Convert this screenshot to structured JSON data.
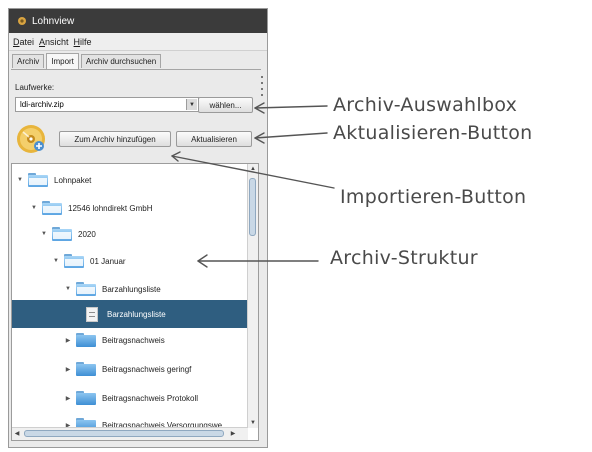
{
  "window": {
    "title": "Lohnview"
  },
  "menu": [
    {
      "mnemonic": "D",
      "rest": "atei"
    },
    {
      "mnemonic": "A",
      "rest": "nsicht"
    },
    {
      "mnemonic": "H",
      "rest": "ilfe"
    }
  ],
  "tabs": [
    "Archiv",
    "Import",
    "Archiv durchsuchen"
  ],
  "active_tab": "Import",
  "import_panel": {
    "drives_label": "Laufwerke:",
    "archive_value": "ldi-archiv.zip",
    "choose_label": "wählen...",
    "add_label": "Zum Archiv hinzufügen",
    "refresh_label": "Aktualisieren"
  },
  "tree": [
    {
      "label": "Lohnpaket",
      "type": "folder",
      "expanded": true
    },
    {
      "label": "12546 lohndirekt GmbH",
      "type": "folder",
      "expanded": true
    },
    {
      "label": "2020",
      "type": "folder",
      "expanded": true
    },
    {
      "label": "01 Januar",
      "type": "folder",
      "expanded": true
    },
    {
      "label": "Barzahlungsliste",
      "type": "folder",
      "expanded": true
    },
    {
      "label": "Barzahlungsliste",
      "type": "document",
      "selected": true
    },
    {
      "label": "Beitragsnachweis",
      "type": "folder",
      "expanded": false
    },
    {
      "label": "Beitragsnachweis geringf",
      "type": "folder",
      "expanded": false
    },
    {
      "label": "Beitragsnachweis Protokoll",
      "type": "folder",
      "expanded": false
    },
    {
      "label": "Beitragsnachweis Versorgungswe",
      "type": "folder",
      "expanded": false
    }
  ],
  "callouts": {
    "archive_box": "Archiv-Auswahlbox",
    "refresh_button": "Aktualisieren-Button",
    "import_button": "Importieren-Button",
    "archive_structure": "Archiv-Struktur"
  },
  "colors": {
    "titlebar": "#3b3b3b",
    "selection": "#2f5e80",
    "folder": "#3e8fd4",
    "callout_text": "#4a4a4a"
  }
}
